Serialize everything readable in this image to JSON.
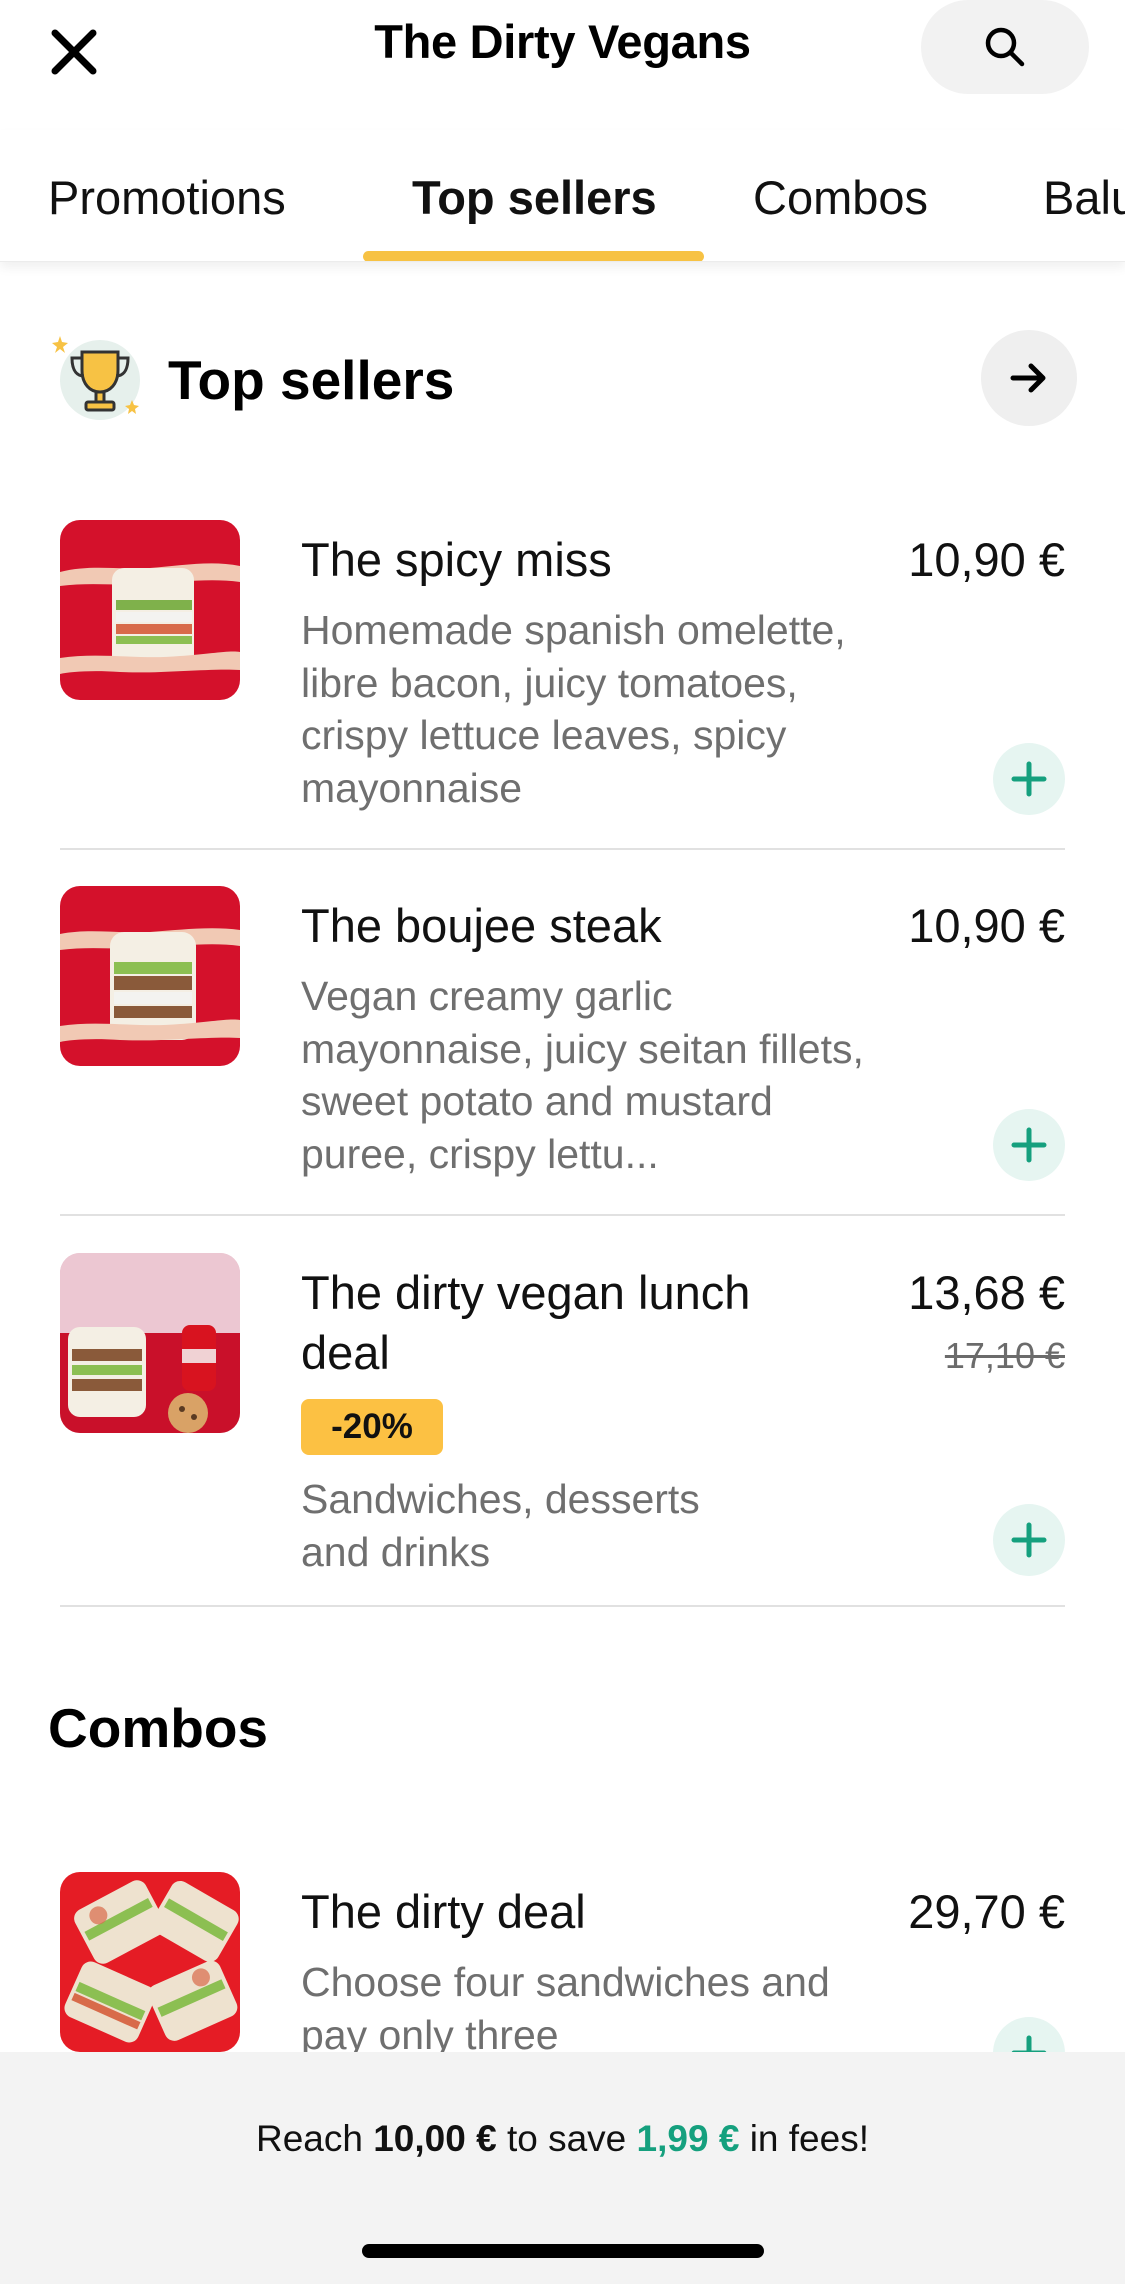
{
  "header": {
    "title": "The Dirty Vegans",
    "close_icon": "close-icon",
    "search_icon": "search-icon"
  },
  "tabs": [
    {
      "label": "Promotions",
      "active": false
    },
    {
      "label": "Top sellers",
      "active": true
    },
    {
      "label": "Combos",
      "active": false
    },
    {
      "label": "Balu",
      "active": false
    }
  ],
  "top_sellers": {
    "title": "Top sellers",
    "icon": "trophy-icon",
    "items": [
      {
        "name": "The spicy miss",
        "price": "10,90 €",
        "description": "Homemade spanish omelette, libre bacon, juicy tomatoes, crispy lettuce leaves, spicy mayonnaise"
      },
      {
        "name": "The boujee steak",
        "price": "10,90 €",
        "description": "Vegan creamy garlic mayonnaise, juicy seitan fillets, sweet potato and mustard puree, crispy lettu..."
      },
      {
        "name": "The dirty vegan lunch deal",
        "price": "13,68 €",
        "old_price": "17,10 €",
        "badge": "-20%",
        "description": "Sandwiches, desserts and drinks"
      }
    ]
  },
  "combos": {
    "title": "Combos",
    "items": [
      {
        "name": "The dirty deal",
        "price": "29,70 €",
        "description": "Choose four sandwiches and pay only three"
      }
    ]
  },
  "footer": {
    "fee_prefix": "Reach",
    "fee_amount": "10,00 €",
    "fee_middle": "to save",
    "fee_savings": "1,99 €",
    "fee_suffix": "in fees!"
  },
  "colors": {
    "accent_yellow": "#f7c244",
    "green": "#15a07e",
    "thumb_red": "#d4112b"
  }
}
